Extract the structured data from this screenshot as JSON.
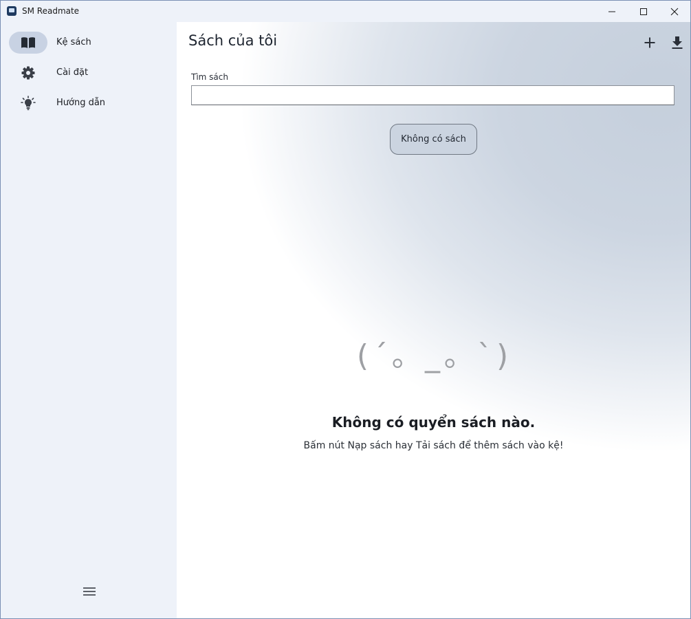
{
  "window": {
    "title": "SM Readmate",
    "controls": {
      "minimize_icon": "minimize-icon",
      "maximize_icon": "maximize-icon",
      "close_icon": "close-icon"
    }
  },
  "sidebar": {
    "items": [
      {
        "label": "Kệ sách",
        "icon": "book-icon",
        "active": true
      },
      {
        "label": "Cài đặt",
        "icon": "gear-icon",
        "active": false
      },
      {
        "label": "Hướng dẫn",
        "icon": "lightbulb-icon",
        "active": false
      }
    ],
    "menu_icon": "hamburger-icon"
  },
  "main": {
    "title": "Sách của tôi",
    "actions": {
      "add_icon": "plus-icon",
      "download_icon": "download-icon"
    },
    "search": {
      "label": "Tìm sách",
      "value": "",
      "placeholder": ""
    },
    "filter_button_label": "Không có sách",
    "empty_state": {
      "emoticon": "(´｡ _｡ `)",
      "title": "Không có quyển sách nào.",
      "subtitle": "Bấm nút Nạp sách hay Tải sách để thêm sách vào kệ!"
    }
  },
  "colors": {
    "accent": "#c8d2e3",
    "sidebar_bg": "#eef2f9",
    "icon": "#3a3f48"
  }
}
